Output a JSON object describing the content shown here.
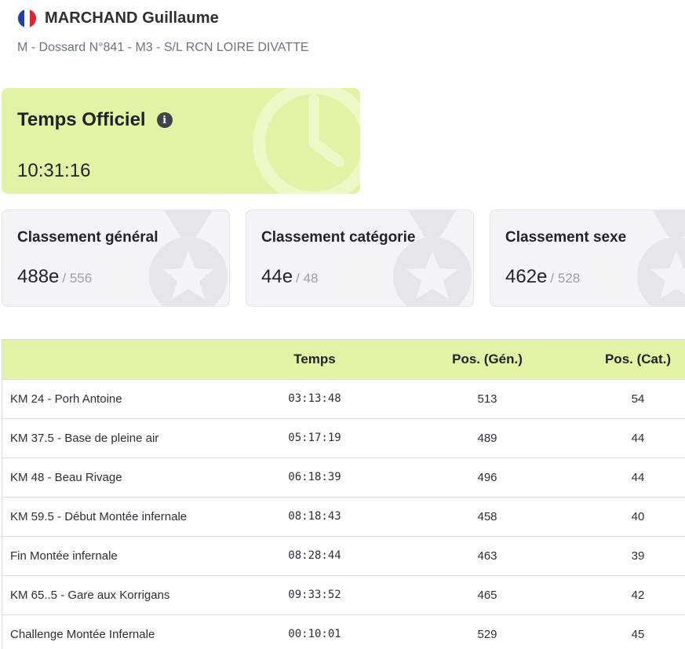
{
  "athlete": {
    "name": "MARCHAND Guillaume",
    "subtitle": "M - Dossard N°841 - M3 - S/L RCN LOIRE DIVATTE",
    "flag_colors": [
      "#1f3fa8",
      "#ffffff",
      "#e1252f"
    ]
  },
  "official_time": {
    "title": "Temps Officiel",
    "info_icon": "i",
    "value": "10:31:16"
  },
  "rankings": [
    {
      "title": "Classement général",
      "rank": "488e",
      "total": "/ 556"
    },
    {
      "title": "Classement catégorie",
      "rank": "44e",
      "total": "/ 48"
    },
    {
      "title": "Classement sexe",
      "rank": "462e",
      "total": "/ 528"
    }
  ],
  "splits": {
    "headers": [
      "",
      "Temps",
      "Pos. (Gén.)",
      "Pos. (Cat.)"
    ],
    "rows": [
      {
        "label": "KM 24 - Porh Antoine",
        "time": "03:13:48",
        "pos_gen": "513",
        "pos_cat": "54"
      },
      {
        "label": "KM 37.5 - Base de pleine air",
        "time": "05:17:19",
        "pos_gen": "489",
        "pos_cat": "44"
      },
      {
        "label": "KM 48 - Beau Rivage",
        "time": "06:18:39",
        "pos_gen": "496",
        "pos_cat": "44"
      },
      {
        "label": "KM 59.5 - Début Montée infernale",
        "time": "08:18:43",
        "pos_gen": "458",
        "pos_cat": "40"
      },
      {
        "label": "Fin Montée infernale",
        "time": "08:28:44",
        "pos_gen": "463",
        "pos_cat": "39"
      },
      {
        "label": "KM 65..5 - Gare aux Korrigans",
        "time": "09:33:52",
        "pos_gen": "465",
        "pos_cat": "42"
      },
      {
        "label": "Challenge Montée Infernale",
        "time": "00:10:01",
        "pos_gen": "529",
        "pos_cat": "45"
      }
    ]
  },
  "colors": {
    "accent": "#e1f3a4",
    "card_bg": "#f3f4f7",
    "muted": "#9aa0a8"
  }
}
